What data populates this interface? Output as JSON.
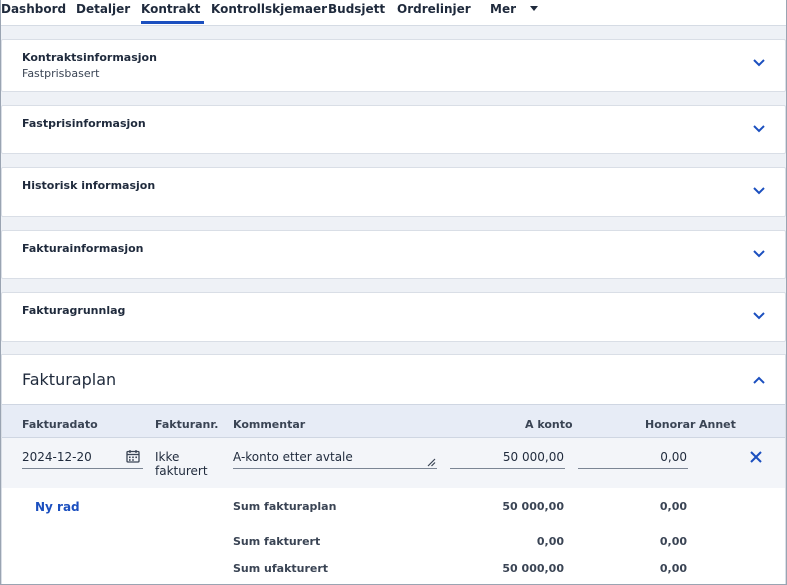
{
  "tabs": [
    {
      "label": "Dashbord"
    },
    {
      "label": "Detaljer"
    },
    {
      "label": "Kontrakt",
      "active": true
    },
    {
      "label": "Kontrollskjemaer"
    },
    {
      "label": "Budsjett"
    },
    {
      "label": "Ordrelinjer"
    },
    {
      "label": "Mer"
    }
  ],
  "panels": [
    {
      "title": "Kontraktsinformasjon",
      "subtitle": "Fastprisbasert"
    },
    {
      "title": "Fastprisinformasjon"
    },
    {
      "title": "Historisk informasjon"
    },
    {
      "title": "Fakturainformasjon"
    },
    {
      "title": "Fakturagrunnlag"
    }
  ],
  "fakturaplan": {
    "title": "Fakturaplan",
    "columns": {
      "dato": "Fakturadato",
      "nr": "Fakturanr.",
      "kommentar": "Kommentar",
      "akonto": "A konto",
      "honorar": "Honorar",
      "annet": "Annet"
    },
    "row": {
      "dato": "2024-12-20",
      "nr_line1": "Ikke",
      "nr_line2": "fakturert",
      "kommentar": "A-konto etter avtale",
      "akonto": "50 000,00",
      "honorar": "0,00"
    },
    "add_row": "Ny rad",
    "sums": [
      {
        "label": "Sum fakturaplan",
        "akonto": "50 000,00",
        "honorar": "0,00"
      },
      {
        "label": "Sum fakturert",
        "akonto": "0,00",
        "honorar": "0,00"
      },
      {
        "label": "Sum ufakturert",
        "akonto": "50 000,00",
        "honorar": "0,00"
      }
    ]
  },
  "colors": {
    "accent": "#1b4fbf"
  }
}
